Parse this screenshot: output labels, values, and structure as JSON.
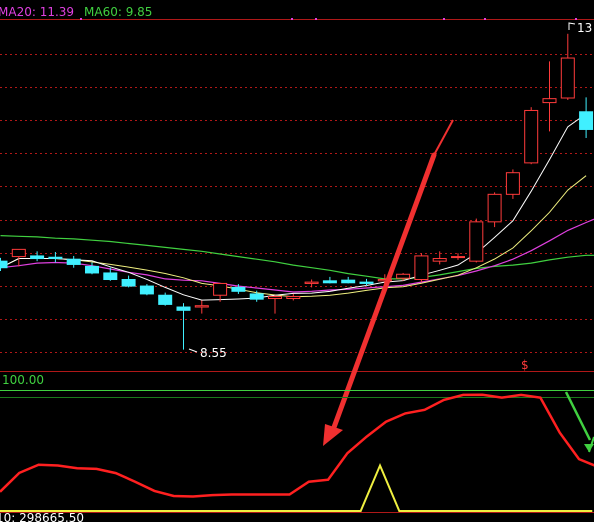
{
  "legend": {
    "ma20": {
      "text": "MA20: 11.39",
      "color": "#e040e0"
    },
    "ma60": {
      "text": "MA60: 9.85",
      "color": "#40d040"
    }
  },
  "labels": {
    "price_high_mark": "13",
    "price_low_mark": "8.55",
    "signal_mark": "$",
    "indicator_top": "100.00",
    "volume_readout": "10: 298665.50"
  },
  "colors": {
    "up": "#ff3b3b",
    "down": "#40f0ff",
    "ma5": "#ffffff",
    "ma10": "#f0f080",
    "ma20": "#e040e0",
    "ma60": "#40d040",
    "grid": "#b01818",
    "annotation_arrow": "#f03030",
    "indicator_main": "#ff2020",
    "indicator_signal": "#f0f040"
  },
  "chart_data": {
    "type": "candlestick",
    "price_axis": {
      "min": 8.3,
      "max": 13.55
    },
    "candles": [
      {
        "o": 9.9,
        "h": 9.95,
        "l": 9.75,
        "c": 9.8
      },
      {
        "o": 9.97,
        "h": 10.05,
        "l": 9.82,
        "c": 10.08
      },
      {
        "o": 9.98,
        "h": 10.05,
        "l": 9.9,
        "c": 9.94
      },
      {
        "o": 9.96,
        "h": 10.04,
        "l": 9.88,
        "c": 9.94
      },
      {
        "o": 9.93,
        "h": 9.98,
        "l": 9.8,
        "c": 9.85
      },
      {
        "o": 9.82,
        "h": 9.88,
        "l": 9.7,
        "c": 9.72
      },
      {
        "o": 9.72,
        "h": 9.8,
        "l": 9.6,
        "c": 9.62
      },
      {
        "o": 9.62,
        "h": 9.68,
        "l": 9.5,
        "c": 9.52
      },
      {
        "o": 9.52,
        "h": 9.55,
        "l": 9.38,
        "c": 9.4
      },
      {
        "o": 9.38,
        "h": 9.42,
        "l": 9.22,
        "c": 9.24
      },
      {
        "o": 9.2,
        "h": 9.26,
        "l": 8.55,
        "c": 9.15
      },
      {
        "o": 9.2,
        "h": 9.3,
        "l": 9.1,
        "c": 9.22
      },
      {
        "o": 9.38,
        "h": 9.48,
        "l": 9.28,
        "c": 9.56
      },
      {
        "o": 9.5,
        "h": 9.55,
        "l": 9.4,
        "c": 9.44
      },
      {
        "o": 9.4,
        "h": 9.45,
        "l": 9.28,
        "c": 9.32
      },
      {
        "o": 9.33,
        "h": 9.38,
        "l": 9.1,
        "c": 9.36
      },
      {
        "o": 9.33,
        "h": 9.4,
        "l": 9.3,
        "c": 9.36
      },
      {
        "o": 9.56,
        "h": 9.62,
        "l": 9.5,
        "c": 9.58
      },
      {
        "o": 9.6,
        "h": 9.66,
        "l": 9.56,
        "c": 9.57
      },
      {
        "o": 9.61,
        "h": 9.66,
        "l": 9.56,
        "c": 9.57
      },
      {
        "o": 9.58,
        "h": 9.63,
        "l": 9.52,
        "c": 9.56
      },
      {
        "o": 9.6,
        "h": 9.7,
        "l": 9.55,
        "c": 9.62
      },
      {
        "o": 9.64,
        "h": 9.72,
        "l": 9.6,
        "c": 9.7
      },
      {
        "o": 9.62,
        "h": 10.02,
        "l": 9.58,
        "c": 9.98
      },
      {
        "o": 9.9,
        "h": 10.05,
        "l": 9.85,
        "c": 9.94
      },
      {
        "o": 9.96,
        "h": 10.02,
        "l": 9.92,
        "c": 9.97
      },
      {
        "o": 9.9,
        "h": 10.55,
        "l": 9.88,
        "c": 10.5
      },
      {
        "o": 10.5,
        "h": 10.95,
        "l": 10.42,
        "c": 10.92
      },
      {
        "o": 10.92,
        "h": 11.3,
        "l": 10.85,
        "c": 11.25
      },
      {
        "o": 11.4,
        "h": 12.25,
        "l": 11.38,
        "c": 12.2
      },
      {
        "o": 12.32,
        "h": 12.95,
        "l": 11.88,
        "c": 12.38
      },
      {
        "o": 12.39,
        "h": 13.37,
        "l": 12.36,
        "c": 13.0
      },
      {
        "o": 12.18,
        "h": 12.4,
        "l": 11.78,
        "c": 11.91
      }
    ],
    "moving_averages": [
      {
        "name": "MA20",
        "values": [
          9.8,
          9.83,
          9.87,
          9.88,
          9.87,
          9.83,
          9.78,
          9.73,
          9.69,
          9.63,
          9.61,
          9.6,
          9.56,
          9.52,
          9.49,
          9.46,
          9.43,
          9.44,
          9.46,
          9.47,
          9.49,
          9.51,
          9.53,
          9.58,
          9.63,
          9.68,
          9.75,
          9.83,
          9.93,
          10.06,
          10.21,
          10.37,
          10.49
        ]
      },
      {
        "name": "MA60",
        "values": [
          10.29,
          10.28,
          10.27,
          10.25,
          10.24,
          10.22,
          10.2,
          10.17,
          10.14,
          10.11,
          10.08,
          10.05,
          10.01,
          9.97,
          9.93,
          9.89,
          9.84,
          9.8,
          9.76,
          9.71,
          9.67,
          9.63,
          9.63,
          9.65,
          9.69,
          9.74,
          9.79,
          9.82,
          9.84,
          9.87,
          9.92,
          9.96,
          9.99
        ]
      }
    ],
    "indicator": {
      "range": [
        0,
        100
      ],
      "top_label": "100.00",
      "main_line": [
        16.52,
        32.08,
        38.77,
        38.15,
        35.94,
        35.36,
        31.91,
        24.84,
        17.26,
        13.14,
        12.68,
        13.89,
        14.38,
        14.38,
        14.38,
        14.38,
        24.81,
        26.45,
        48.22,
        61.79,
        73.98,
        80.84,
        83.74,
        91.86,
        96.02,
        96.04,
        93.8,
        96.02,
        93.8,
        65.12,
        43.39,
        36.87
      ],
      "signal_line": [
        0,
        0,
        0,
        0,
        0,
        0,
        0,
        0,
        0,
        0,
        0,
        0,
        0,
        0,
        0,
        0,
        0,
        0,
        0,
        0,
        38.12,
        0,
        0,
        0,
        0,
        0,
        0,
        0,
        0,
        0,
        0,
        0
      ],
      "reference_level": 93.86
    }
  }
}
